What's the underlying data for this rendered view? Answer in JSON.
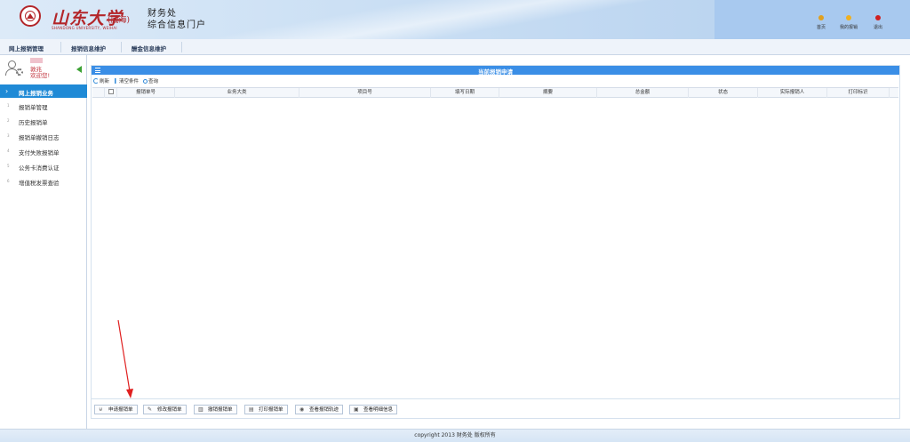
{
  "header": {
    "uni_name": "山东大学",
    "uni_branch": "(威海)",
    "uni_en": "SHANDONG UNIVERSITY, WEIHAI",
    "dept_line1": "财务处",
    "dept_line2": "综合信息门户",
    "right_buttons": [
      {
        "label": "首页",
        "icon": "home-dot-icon",
        "color": "#e0a020"
      },
      {
        "label": "我的报销",
        "icon": "my-reimburse-dot-icon",
        "color": "#f0b020"
      },
      {
        "label": "退出",
        "icon": "logout-dot-icon",
        "color": "#d02020"
      }
    ]
  },
  "topnav": {
    "tabs": [
      {
        "label": "网上报销管理"
      },
      {
        "label": "报销信息维护"
      },
      {
        "label": "酬金信息维护"
      }
    ]
  },
  "sidebar": {
    "user_name": "敦兆",
    "welcome": "欢迎您!",
    "active": {
      "label": "网上报销业务"
    },
    "items": [
      {
        "num": "1",
        "label": "报销单管理"
      },
      {
        "num": "2",
        "label": "历史报销单"
      },
      {
        "num": "3",
        "label": "报销单撤销日志"
      },
      {
        "num": "4",
        "label": "支付失败报销单"
      },
      {
        "num": "5",
        "label": "公务卡消费认证"
      },
      {
        "num": "6",
        "label": "增值税发票查验"
      }
    ]
  },
  "main": {
    "title": "当前报销申请",
    "toolbar": {
      "refresh": "刷新",
      "clear": "清空条件",
      "search": "查询"
    },
    "columns": [
      "报销单号",
      "业务大类",
      "项目号",
      "填写日期",
      "摘要",
      "总金额",
      "状态",
      "实际报销人",
      "打印标识"
    ],
    "bottom_buttons": [
      {
        "label": "申请报销单",
        "icon": "cart-icon",
        "glyph": "⊌"
      },
      {
        "label": "修改报销单",
        "icon": "edit-icon",
        "glyph": "✎"
      },
      {
        "label": "撤销报销单",
        "icon": "trash-icon",
        "glyph": "▥"
      },
      {
        "label": "打印报销单",
        "icon": "printer-icon",
        "glyph": "▤"
      },
      {
        "label": "查看报销轨迹",
        "icon": "eye-icon",
        "glyph": "◉"
      },
      {
        "label": "查看明细信息",
        "icon": "detail-icon",
        "glyph": "▣"
      }
    ]
  },
  "footer": {
    "text": "copyright 2013 财务处 版权所有"
  }
}
